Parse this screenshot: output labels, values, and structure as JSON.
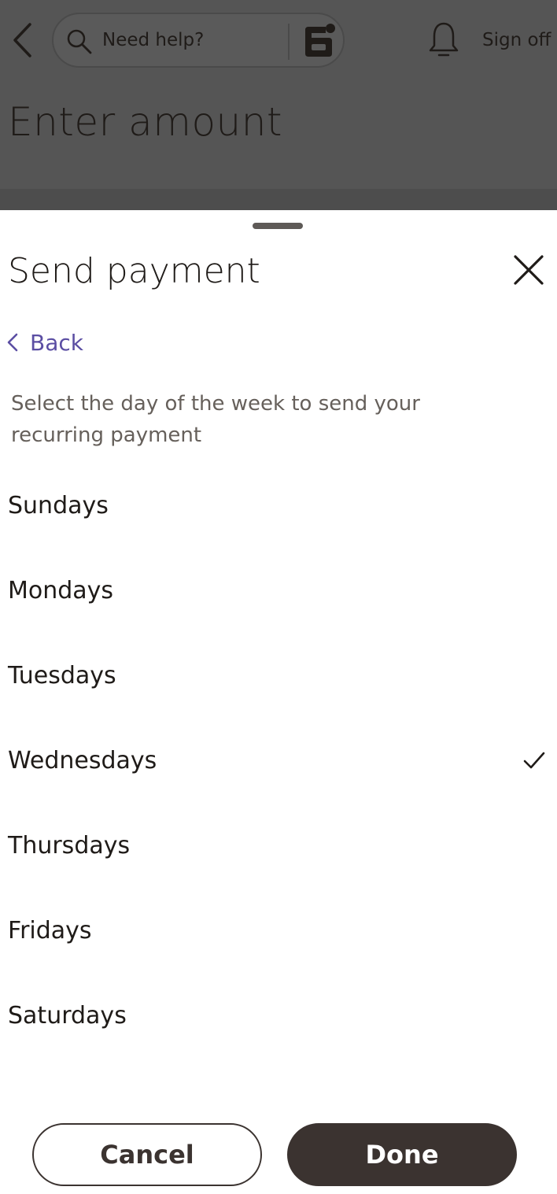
{
  "background": {
    "search": {
      "placeholder": "Need help?"
    },
    "sign_off_label": "Sign off",
    "title": "Enter amount"
  },
  "sheet": {
    "title": "Send payment",
    "back_label": "Back",
    "instructions": "Select the day of the week to send your recurring payment",
    "days": [
      {
        "label": "Sundays",
        "selected": false
      },
      {
        "label": "Mondays",
        "selected": false
      },
      {
        "label": "Tuesdays",
        "selected": false
      },
      {
        "label": "Wednesdays",
        "selected": true
      },
      {
        "label": "Thursdays",
        "selected": false
      },
      {
        "label": "Fridays",
        "selected": false
      },
      {
        "label": "Saturdays",
        "selected": false
      }
    ],
    "cancel_label": "Cancel",
    "done_label": "Done"
  },
  "colors": {
    "accent_link": "#5b4ea3",
    "primary_button": "#3b3330",
    "overlay": "#555555"
  },
  "icons": [
    "chevron-left-icon",
    "search-icon",
    "assistant-icon",
    "bell-icon",
    "close-icon",
    "checkmark-icon"
  ]
}
